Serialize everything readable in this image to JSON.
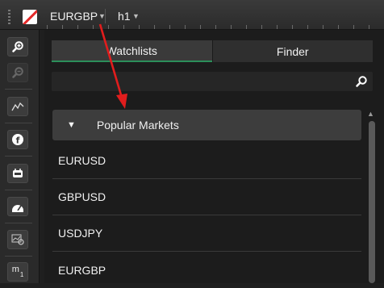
{
  "topbar": {
    "symbol": "EURGBP",
    "timeframe": "h1",
    "icons": {
      "grip": "drag-grip-icon",
      "chart": "chart-color-icon",
      "caret": "caret-down-icon"
    }
  },
  "sidebar": {
    "buttons": [
      "zoom-in-icon",
      "zoom-out-icon",
      "indicator-icon",
      "facebook-icon",
      "robot-icon",
      "gauge-icon",
      "settings-chart-icon",
      "m1-timeframe-icon"
    ],
    "m1_label": "m",
    "m1_sub": "1"
  },
  "panel": {
    "tabs": [
      {
        "label": "Watchlists",
        "active": true
      },
      {
        "label": "Finder",
        "active": false
      }
    ],
    "search": {
      "value": "",
      "placeholder": ""
    },
    "group": {
      "label": "Popular Markets",
      "expanded": true
    },
    "markets": [
      "EURUSD",
      "GBPUSD",
      "USDJPY",
      "EURGBP"
    ]
  },
  "colors": {
    "accent_tab": "#2c8f5a",
    "annotation_arrow": "#e11d1d",
    "background": "#1c1c1c"
  }
}
